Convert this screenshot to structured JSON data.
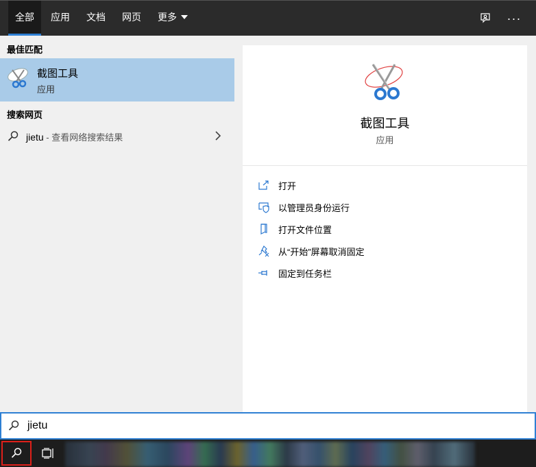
{
  "tabs": [
    {
      "label": "全部",
      "active": true
    },
    {
      "label": "应用"
    },
    {
      "label": "文档"
    },
    {
      "label": "网页"
    },
    {
      "label": "更多"
    }
  ],
  "top_icons": {
    "feedback": "feedback-icon",
    "more": "···"
  },
  "left": {
    "best_match_title": "最佳匹配",
    "best_match": {
      "name": "截图工具",
      "type": "应用",
      "icon": "snipping-tool-icon"
    },
    "web_title": "搜索网页",
    "web_item": {
      "query": "jietu",
      "suffix": " - 查看网络搜索结果"
    }
  },
  "right": {
    "app_name": "截图工具",
    "app_type": "应用",
    "actions": [
      {
        "label": "打开",
        "icon": "open-icon"
      },
      {
        "label": "以管理员身份运行",
        "icon": "shield-icon"
      },
      {
        "label": "打开文件位置",
        "icon": "file-location-icon"
      },
      {
        "label": "从“开始”屏幕取消固定",
        "icon": "unpin-icon"
      },
      {
        "label": "固定到任务栏",
        "icon": "pin-icon"
      }
    ]
  },
  "search": {
    "value": "jietu"
  },
  "colors": {
    "accent": "#2d7fd3",
    "selected": "#a9cbe8",
    "highlight_border": "#e0201a"
  }
}
